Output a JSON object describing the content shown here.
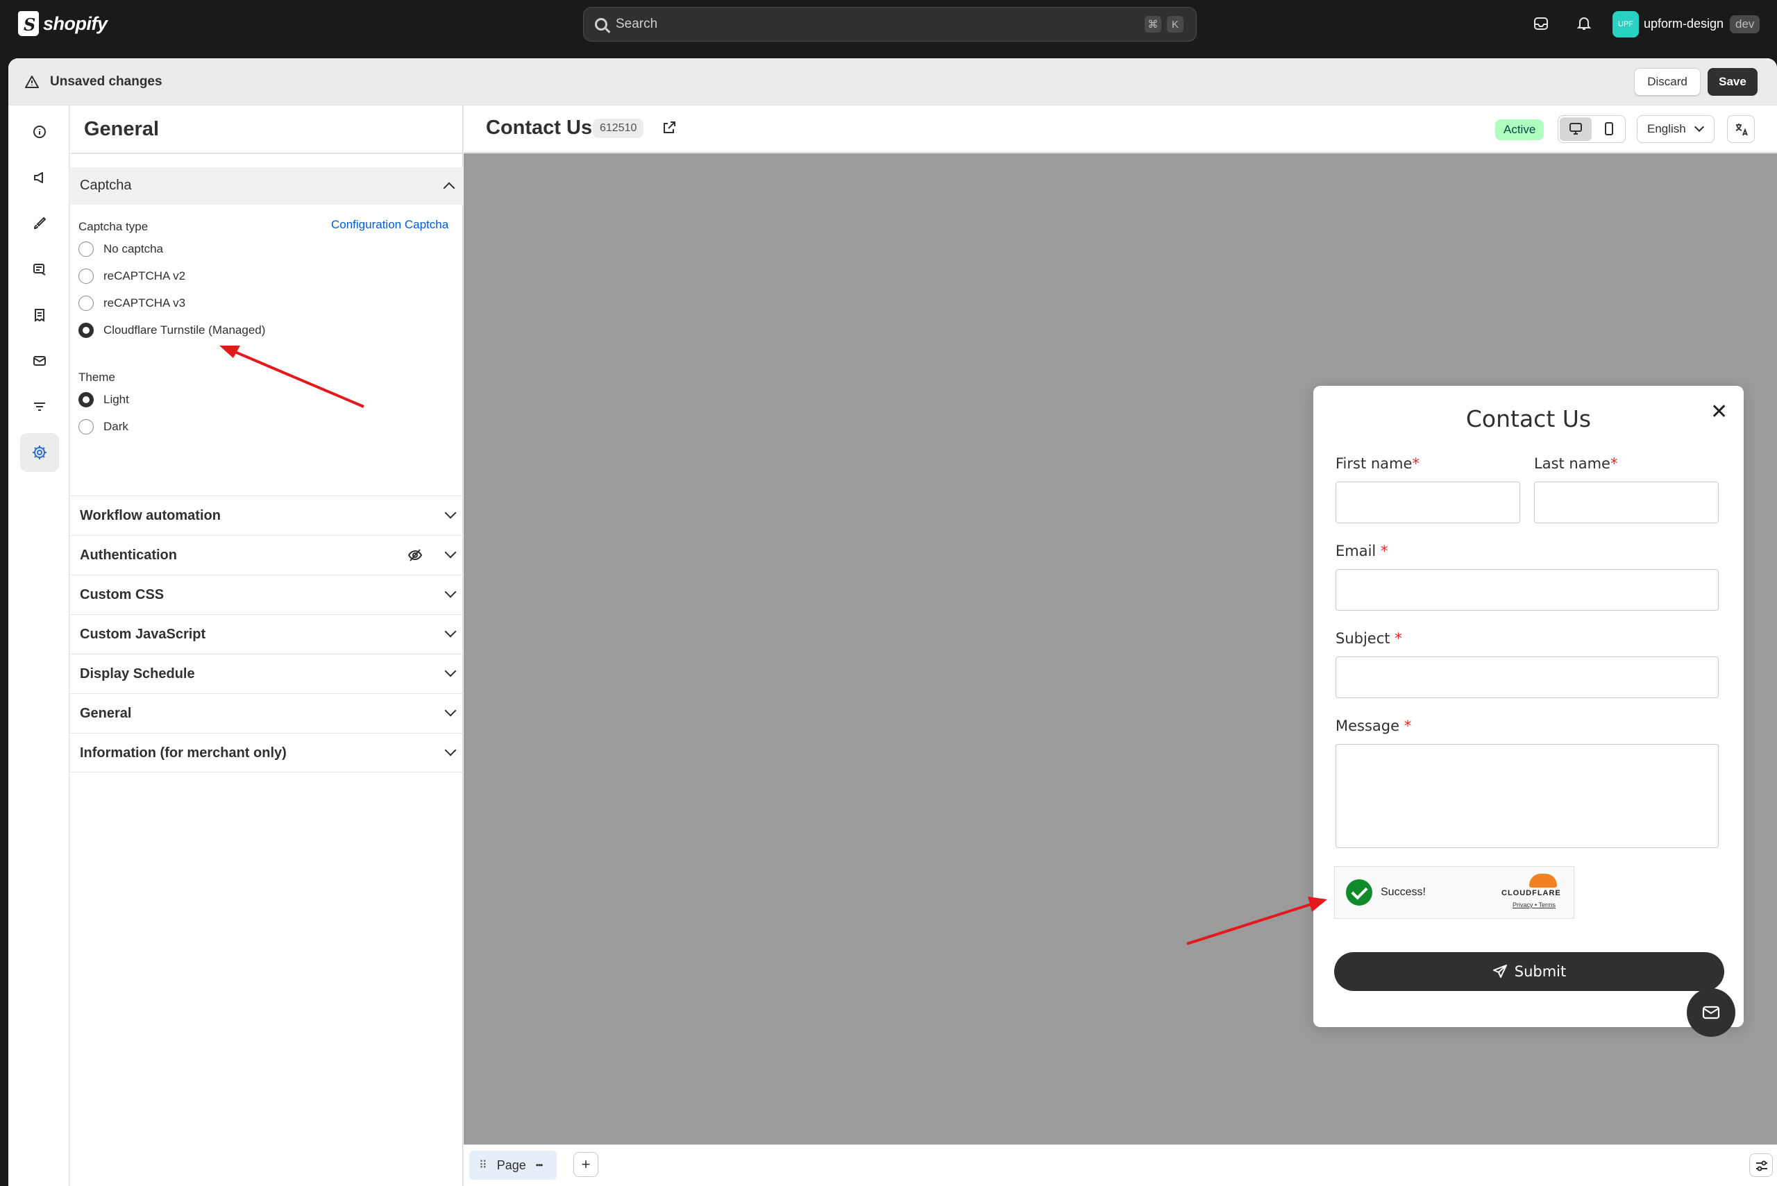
{
  "topbar": {
    "logo_text": "shopify",
    "search_placeholder": "Search",
    "shortcut_keys": [
      "⌘",
      "K"
    ],
    "avatar_initials": "UPF",
    "store_name": "upform-design",
    "store_badge": "dev"
  },
  "savebar": {
    "message": "Unsaved changes",
    "discard_label": "Discard",
    "save_label": "Save"
  },
  "rail": {
    "items": [
      "info-icon",
      "megaphone-icon",
      "brush-icon",
      "layers-icon",
      "receipt-icon",
      "mail-icon",
      "filter-icon",
      "gear-icon"
    ],
    "active": "gear-icon"
  },
  "panel": {
    "title": "General",
    "captcha_section": {
      "title": "Captcha",
      "type_label": "Captcha type",
      "config_link": "Configuration Captcha",
      "options": [
        "No captcha",
        "reCAPTCHA v2",
        "reCAPTCHA v3",
        "Cloudflare Turnstile (Managed)"
      ],
      "selected": "Cloudflare Turnstile (Managed)",
      "theme_label": "Theme",
      "theme_options": [
        "Light",
        "Dark"
      ],
      "theme_selected": "Light"
    },
    "sections": [
      {
        "label": "Workflow automation"
      },
      {
        "label": "Authentication"
      },
      {
        "label": "Custom CSS"
      },
      {
        "label": "Custom JavaScript"
      },
      {
        "label": "Display Schedule"
      },
      {
        "label": "General"
      },
      {
        "label": "Information (for merchant only)"
      }
    ]
  },
  "preview": {
    "form_title": "Contact Us",
    "form_id": "612510",
    "status": "Active",
    "language": "English",
    "status_color": "#affebf"
  },
  "form": {
    "title": "Contact Us",
    "close": "✕",
    "first_name": "First name",
    "last_name": "Last name",
    "email": "Email",
    "subject": "Subject",
    "message": "Message",
    "required_mark": "*",
    "turnstile_status": "Success!",
    "turnstile_brand": "CLOUDFLARE",
    "turnstile_links": "Privacy • Terms",
    "submit_label": "Submit"
  },
  "bottombar": {
    "page_tab": "Page",
    "more": "•••",
    "add": "+"
  }
}
